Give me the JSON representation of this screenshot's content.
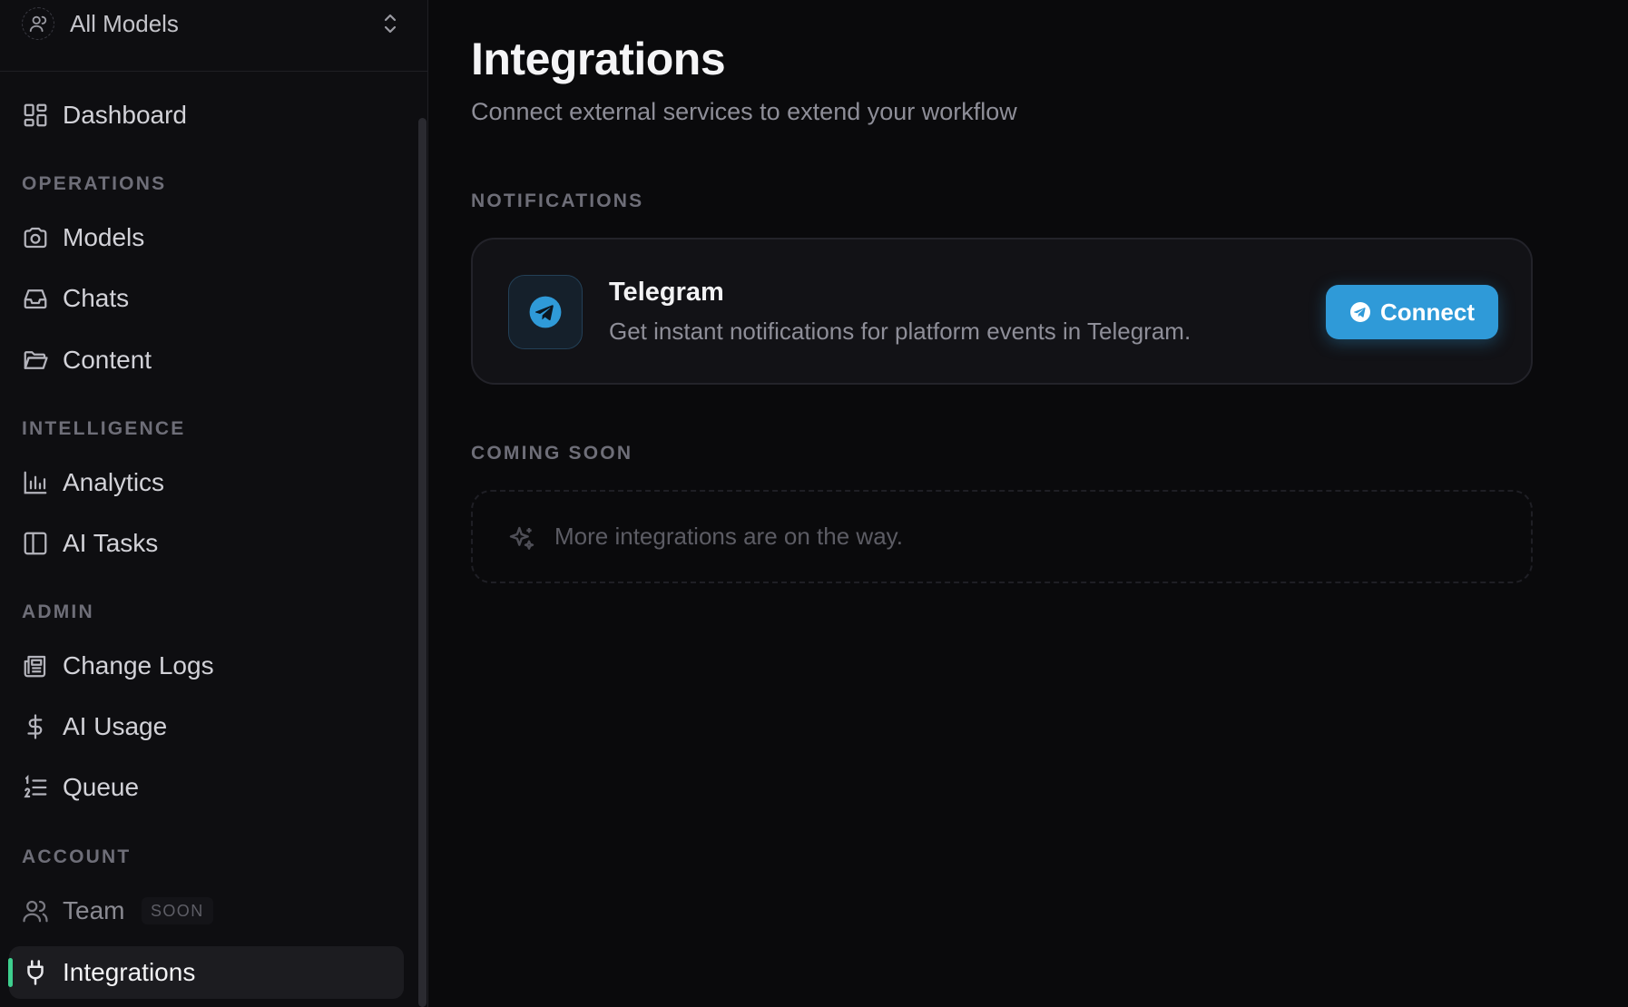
{
  "model_switcher": {
    "label": "All Models"
  },
  "sidebar": {
    "dashboard": "Dashboard",
    "sections": {
      "operations": "OPERATIONS",
      "intelligence": "INTELLIGENCE",
      "admin": "ADMIN",
      "account": "ACCOUNT"
    },
    "items": {
      "models": "Models",
      "chats": "Chats",
      "content": "Content",
      "analytics": "Analytics",
      "ai_tasks": "AI Tasks",
      "change_logs": "Change Logs",
      "ai_usage": "AI Usage",
      "queue": "Queue",
      "team": "Team",
      "team_badge": "SOON",
      "integrations": "Integrations"
    },
    "active_item": "integrations",
    "accent_color": "#3ecf8e"
  },
  "main": {
    "title": "Integrations",
    "subtitle": "Connect external services to extend your workflow",
    "notifications_label": "NOTIFICATIONS",
    "telegram": {
      "name": "Telegram",
      "description": "Get instant notifications for platform events in Telegram.",
      "connect_label": "Connect",
      "icon": "telegram-icon",
      "brand_color": "#2f9ad8"
    },
    "coming_soon_label": "COMING SOON",
    "coming_soon_message": "More integrations are on the way."
  }
}
